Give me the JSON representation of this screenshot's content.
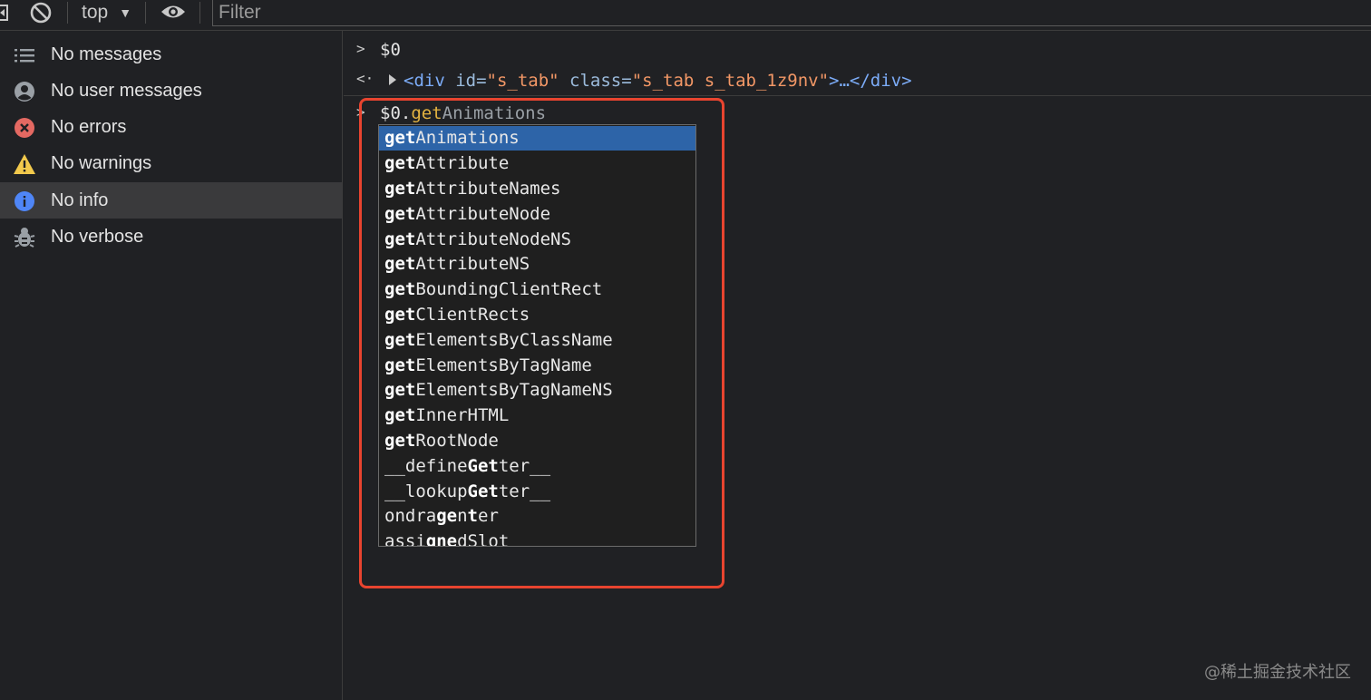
{
  "toolbar": {
    "context_label": "top",
    "filter_placeholder": "Filter"
  },
  "sidebar": {
    "items": [
      {
        "label": "No messages",
        "icon": "list-icon"
      },
      {
        "label": "No user messages",
        "icon": "user-icon"
      },
      {
        "label": "No errors",
        "icon": "error-icon"
      },
      {
        "label": "No warnings",
        "icon": "warning-icon"
      },
      {
        "label": "No info",
        "icon": "info-icon"
      },
      {
        "label": "No verbose",
        "icon": "bug-icon"
      }
    ],
    "selected_index": 4
  },
  "console": {
    "history": [
      {
        "text": "$0"
      }
    ],
    "result": {
      "tag_open": "<div",
      "attr1_name": " id=",
      "attr1_value": "\"s_tab\"",
      "attr2_name": " class=",
      "attr2_value": "\"s_tab s_tab_1z9nv\"",
      "tag_close": ">…</div>"
    },
    "input": {
      "object": "$0.",
      "typed": "get",
      "suggestion": "Animations"
    }
  },
  "autocomplete": {
    "selected_index": 0,
    "items": [
      {
        "pre": "",
        "bold": "get",
        "post": "Animations"
      },
      {
        "pre": "",
        "bold": "get",
        "post": "Attribute"
      },
      {
        "pre": "",
        "bold": "get",
        "post": "AttributeNames"
      },
      {
        "pre": "",
        "bold": "get",
        "post": "AttributeNode"
      },
      {
        "pre": "",
        "bold": "get",
        "post": "AttributeNodeNS"
      },
      {
        "pre": "",
        "bold": "get",
        "post": "AttributeNS"
      },
      {
        "pre": "",
        "bold": "get",
        "post": "BoundingClientRect"
      },
      {
        "pre": "",
        "bold": "get",
        "post": "ClientRects"
      },
      {
        "pre": "",
        "bold": "get",
        "post": "ElementsByClassName"
      },
      {
        "pre": "",
        "bold": "get",
        "post": "ElementsByTagName"
      },
      {
        "pre": "",
        "bold": "get",
        "post": "ElementsByTagNameNS"
      },
      {
        "pre": "",
        "bold": "get",
        "post": "InnerHTML"
      },
      {
        "pre": "",
        "bold": "get",
        "post": "RootNode"
      },
      {
        "pre": "__define",
        "bold": "Get",
        "post": "ter__"
      },
      {
        "pre": "__lookup",
        "bold": "Get",
        "post": "ter__"
      },
      {
        "pre": "ondra",
        "bold": "ge",
        "post": "n",
        "bold2": "t",
        "post2": "er"
      },
      {
        "pre": "assi",
        "bold": "g",
        "post": "",
        "bold2": "ne",
        "post2": "dSlot"
      }
    ]
  },
  "watermark": "@稀土掘金技术社区",
  "colors": {
    "highlight_frame": "#e8442f",
    "selection": "#2d64a8",
    "error_red": "#e46962",
    "warning_yellow": "#f2c94c",
    "info_blue": "#4f86f7"
  }
}
